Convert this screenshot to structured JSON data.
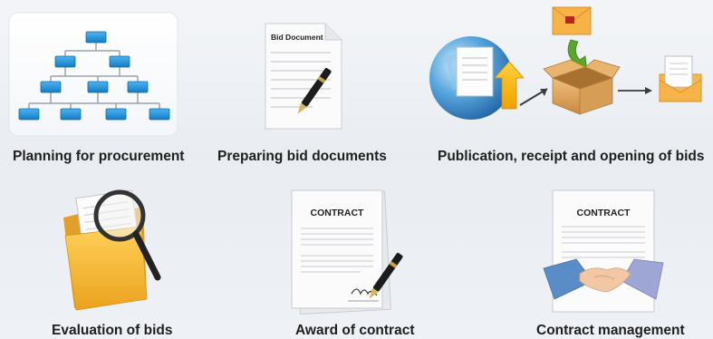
{
  "steps": [
    {
      "label": "Planning for procurement",
      "icon": "hierarchy-chart-icon"
    },
    {
      "label": "Preparing bid documents",
      "icon": "bid-document-icon",
      "doc_title": "Bid Document"
    },
    {
      "label": "Publication, receipt and opening of bids",
      "icon": "publication-flow-icon"
    },
    {
      "label": "Evaluation of bids",
      "icon": "magnifier-folder-icon"
    },
    {
      "label": "Award of contract",
      "icon": "signed-contract-icon",
      "doc_title": "CONTRACT"
    },
    {
      "label": "Contract management",
      "icon": "handshake-contract-icon",
      "doc_title": "CONTRACT"
    }
  ],
  "colors": {
    "node_blue": "#1f8fd6",
    "folder_yellow": "#f2b632",
    "envelope_orange": "#f6b347",
    "arrow_green": "#5aa52b"
  }
}
